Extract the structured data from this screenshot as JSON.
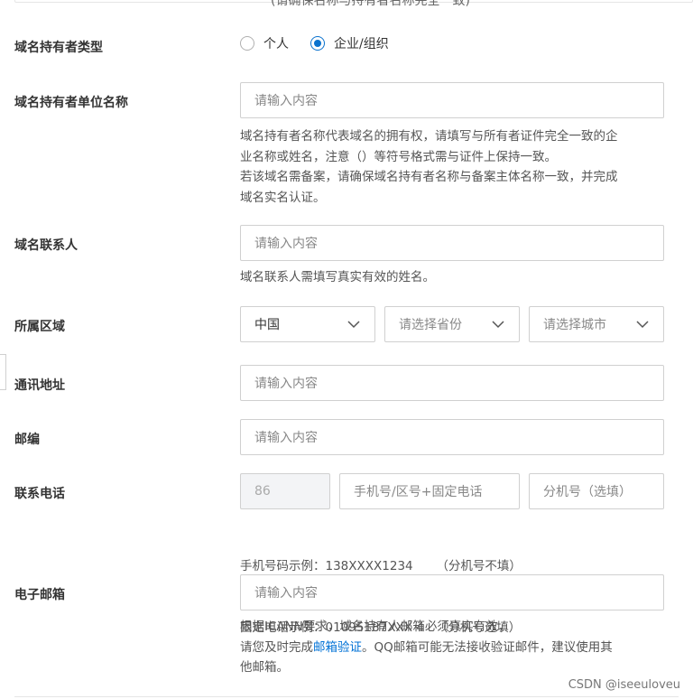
{
  "top_note": "(请确保名称与持有者名称完全一致)",
  "fields": {
    "holder_type": {
      "label": "域名持有者类型",
      "options": [
        "个人",
        "企业/组织"
      ],
      "selected": "企业/组织"
    },
    "org_name": {
      "label": "域名持有者单位名称",
      "placeholder": "请输入内容",
      "help": [
        "域名持有者名称代表域名的拥有权，请填写与所有者证件完全一致的企",
        "业名称或姓名，注意（）等符号格式需与证件上保持一致。",
        "若该域名需备案，请确保域名持有者名称与备案主体名称一致，并完成",
        "域名实名认证。"
      ]
    },
    "contact": {
      "label": "域名联系人",
      "placeholder": "请输入内容",
      "help": "域名联系人需填写真实有效的姓名。"
    },
    "region": {
      "label": "所属区域",
      "country": "中国",
      "province": "请选择省份",
      "city": "请选择城市"
    },
    "address": {
      "label": "通讯地址",
      "placeholder": "请输入内容"
    },
    "postcode": {
      "label": "邮编",
      "placeholder": "请输入内容"
    },
    "phone": {
      "label": "联系电话",
      "country_code": "86",
      "number_placeholder": "手机号/区号+固定电话",
      "ext_placeholder": "分机号（选填）",
      "help": [
        "手机号码示例：138XXXX1234      （分机号不填）",
        "固定电话示例：01095187XXX 4   （分机号选填）"
      ]
    },
    "email": {
      "label": "电子邮箱",
      "placeholder": "请输入内容",
      "help_line1": "根据ICANN要求，域名持有人邮箱必须真实有效，",
      "help_line2_pre": "请您及时完成",
      "help_link": "邮箱验证",
      "help_line2_post": "。QQ邮箱可能无法接收验证邮件，建议使用其",
      "help_line3": "他邮箱。"
    }
  },
  "watermark": "CSDN @iseeuloveu",
  "colors": {
    "accent": "#0a72ce",
    "link": "#0072d6"
  },
  "icons": {
    "select_arrow": "chevron-down-icon"
  }
}
